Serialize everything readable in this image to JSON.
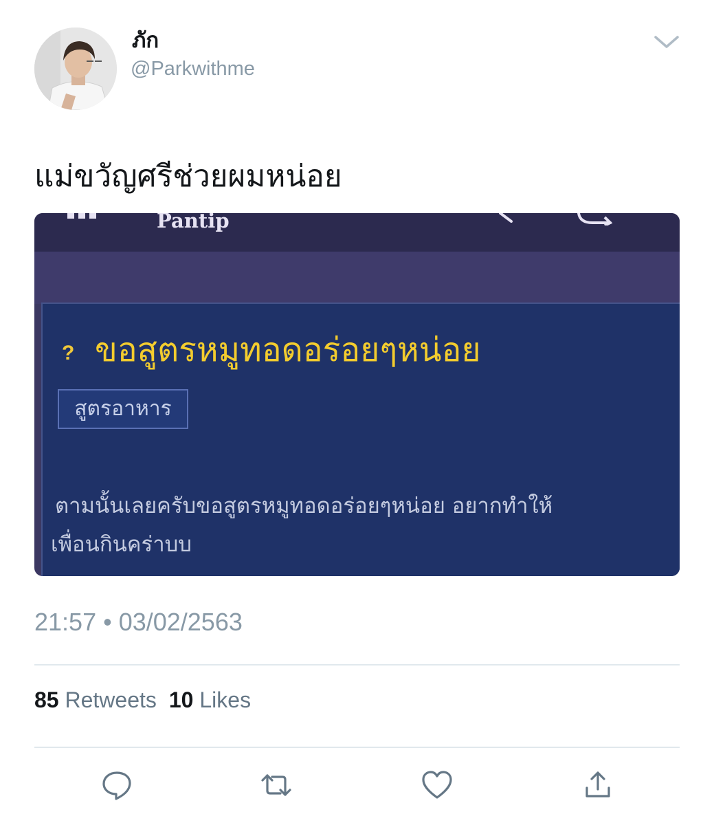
{
  "user": {
    "display_name": "ภัก",
    "handle": "@Parkwithme"
  },
  "tweet": {
    "text": "แม่ขวัญศรีช่วยผมหน่อย",
    "timestamp": "21:57 • 03/02/2563"
  },
  "media": {
    "site_name": "Pantip",
    "post_title": "ขอสูตรหมูทอดอร่อยๆหน่อย",
    "question_marker": "?",
    "tag": "สูตรอาหาร",
    "body_line1": "ตามนั้นเลยครับขอสูตรหมูทอดอร่อยๆหน่อย อยากทำให้",
    "body_line2": "เพื่อนกินคร่าบบ"
  },
  "stats": {
    "retweets_count": "85",
    "retweets_label": "Retweets",
    "likes_count": "10",
    "likes_label": "Likes"
  },
  "actions": {
    "icons": [
      "reply-icon",
      "retweet-icon",
      "like-icon",
      "share-icon"
    ]
  },
  "colors": {
    "muted": "#8899a6",
    "icon": "#657786",
    "pantip_panel": "#1f3268",
    "pantip_title": "#f3cc2e"
  }
}
